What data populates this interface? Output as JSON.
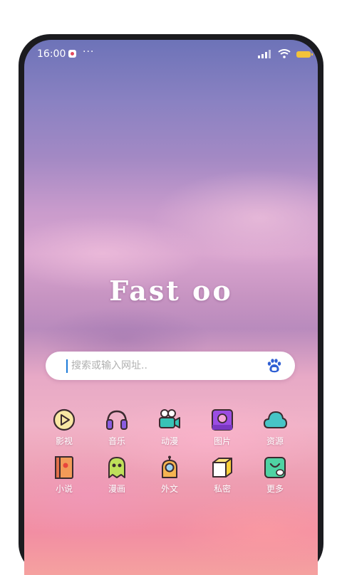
{
  "status_bar": {
    "time": "16:00",
    "dots": "···"
  },
  "logo": {
    "text": "Fast oo"
  },
  "search": {
    "placeholder": "搜索或输入网址.."
  },
  "grid": {
    "row1": [
      {
        "label": "影视",
        "icon": "play-icon"
      },
      {
        "label": "音乐",
        "icon": "headphones-icon"
      },
      {
        "label": "动漫",
        "icon": "camera-icon"
      },
      {
        "label": "图片",
        "icon": "image-icon"
      },
      {
        "label": "资源",
        "icon": "cloud-icon"
      }
    ],
    "row2": [
      {
        "label": "小说",
        "icon": "book-icon"
      },
      {
        "label": "漫画",
        "icon": "ghost-icon"
      },
      {
        "label": "外文",
        "icon": "robot-icon"
      },
      {
        "label": "私密",
        "icon": "box-icon"
      },
      {
        "label": "更多",
        "icon": "bag-icon"
      }
    ]
  },
  "colors": {
    "accent": "#1c7bd9",
    "battery": "#f2c23a",
    "icon_outline": "#3b2a2f",
    "play_yellow": "#f8e7a3",
    "headphone_purple": "#8a5ce0",
    "camera_teal": "#37c3b6",
    "image_purple": "#9b4de3",
    "cloud_teal": "#47c4c6",
    "book_orange": "#f29b58",
    "ghost_green": "#bfe05a",
    "robot_orange": "#f5b451",
    "box_yellow": "#f8cf3a",
    "bag_green": "#4fd3a3"
  }
}
